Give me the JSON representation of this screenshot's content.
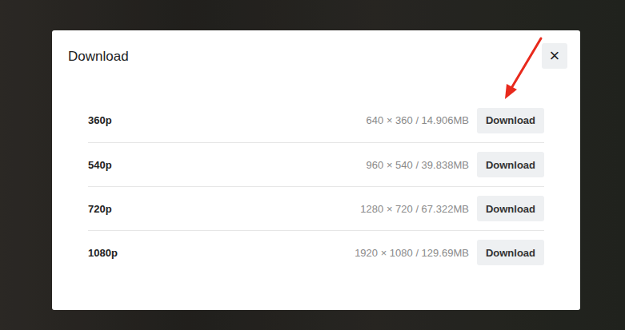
{
  "dialog": {
    "title": "Download",
    "close": "×"
  },
  "options": [
    {
      "label": "360p",
      "info": "640 × 360 / 14.906MB",
      "button": "Download"
    },
    {
      "label": "540p",
      "info": "960 × 540 / 39.838MB",
      "button": "Download"
    },
    {
      "label": "720p",
      "info": "1280 × 720 / 67.322MB",
      "button": "Download"
    },
    {
      "label": "1080p",
      "info": "1920 × 1080 / 129.69MB",
      "button": "Download"
    }
  ]
}
